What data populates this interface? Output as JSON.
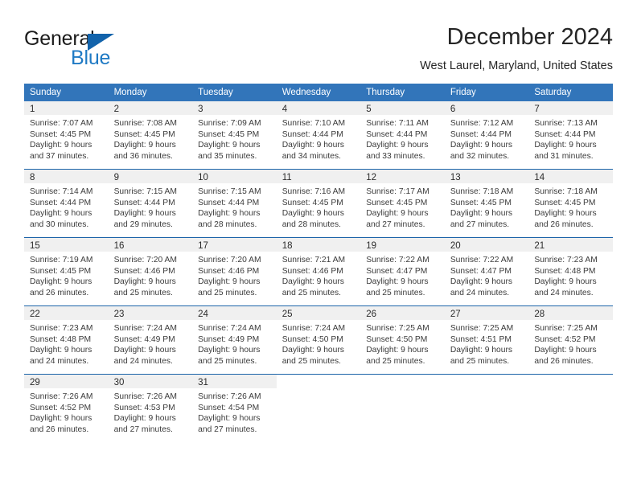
{
  "brand": {
    "name_part1": "General",
    "name_part2": "Blue"
  },
  "header": {
    "month_title": "December 2024",
    "location": "West Laurel, Maryland, United States"
  },
  "colors": {
    "header_blue": "#3275ba",
    "separator_blue": "#1b63a8",
    "daynum_band": "#f0f0f0",
    "brand_blue": "#1f7ac4",
    "logo_triangle": "#1263ab"
  },
  "weekday_headers": [
    "Sunday",
    "Monday",
    "Tuesday",
    "Wednesday",
    "Thursday",
    "Friday",
    "Saturday"
  ],
  "weeks": [
    [
      {
        "day": "1",
        "sunrise": "Sunrise: 7:07 AM",
        "sunset": "Sunset: 4:45 PM",
        "daylight1": "Daylight: 9 hours",
        "daylight2": "and 37 minutes."
      },
      {
        "day": "2",
        "sunrise": "Sunrise: 7:08 AM",
        "sunset": "Sunset: 4:45 PM",
        "daylight1": "Daylight: 9 hours",
        "daylight2": "and 36 minutes."
      },
      {
        "day": "3",
        "sunrise": "Sunrise: 7:09 AM",
        "sunset": "Sunset: 4:45 PM",
        "daylight1": "Daylight: 9 hours",
        "daylight2": "and 35 minutes."
      },
      {
        "day": "4",
        "sunrise": "Sunrise: 7:10 AM",
        "sunset": "Sunset: 4:44 PM",
        "daylight1": "Daylight: 9 hours",
        "daylight2": "and 34 minutes."
      },
      {
        "day": "5",
        "sunrise": "Sunrise: 7:11 AM",
        "sunset": "Sunset: 4:44 PM",
        "daylight1": "Daylight: 9 hours",
        "daylight2": "and 33 minutes."
      },
      {
        "day": "6",
        "sunrise": "Sunrise: 7:12 AM",
        "sunset": "Sunset: 4:44 PM",
        "daylight1": "Daylight: 9 hours",
        "daylight2": "and 32 minutes."
      },
      {
        "day": "7",
        "sunrise": "Sunrise: 7:13 AM",
        "sunset": "Sunset: 4:44 PM",
        "daylight1": "Daylight: 9 hours",
        "daylight2": "and 31 minutes."
      }
    ],
    [
      {
        "day": "8",
        "sunrise": "Sunrise: 7:14 AM",
        "sunset": "Sunset: 4:44 PM",
        "daylight1": "Daylight: 9 hours",
        "daylight2": "and 30 minutes."
      },
      {
        "day": "9",
        "sunrise": "Sunrise: 7:15 AM",
        "sunset": "Sunset: 4:44 PM",
        "daylight1": "Daylight: 9 hours",
        "daylight2": "and 29 minutes."
      },
      {
        "day": "10",
        "sunrise": "Sunrise: 7:15 AM",
        "sunset": "Sunset: 4:44 PM",
        "daylight1": "Daylight: 9 hours",
        "daylight2": "and 28 minutes."
      },
      {
        "day": "11",
        "sunrise": "Sunrise: 7:16 AM",
        "sunset": "Sunset: 4:45 PM",
        "daylight1": "Daylight: 9 hours",
        "daylight2": "and 28 minutes."
      },
      {
        "day": "12",
        "sunrise": "Sunrise: 7:17 AM",
        "sunset": "Sunset: 4:45 PM",
        "daylight1": "Daylight: 9 hours",
        "daylight2": "and 27 minutes."
      },
      {
        "day": "13",
        "sunrise": "Sunrise: 7:18 AM",
        "sunset": "Sunset: 4:45 PM",
        "daylight1": "Daylight: 9 hours",
        "daylight2": "and 27 minutes."
      },
      {
        "day": "14",
        "sunrise": "Sunrise: 7:18 AM",
        "sunset": "Sunset: 4:45 PM",
        "daylight1": "Daylight: 9 hours",
        "daylight2": "and 26 minutes."
      }
    ],
    [
      {
        "day": "15",
        "sunrise": "Sunrise: 7:19 AM",
        "sunset": "Sunset: 4:45 PM",
        "daylight1": "Daylight: 9 hours",
        "daylight2": "and 26 minutes."
      },
      {
        "day": "16",
        "sunrise": "Sunrise: 7:20 AM",
        "sunset": "Sunset: 4:46 PM",
        "daylight1": "Daylight: 9 hours",
        "daylight2": "and 25 minutes."
      },
      {
        "day": "17",
        "sunrise": "Sunrise: 7:20 AM",
        "sunset": "Sunset: 4:46 PM",
        "daylight1": "Daylight: 9 hours",
        "daylight2": "and 25 minutes."
      },
      {
        "day": "18",
        "sunrise": "Sunrise: 7:21 AM",
        "sunset": "Sunset: 4:46 PM",
        "daylight1": "Daylight: 9 hours",
        "daylight2": "and 25 minutes."
      },
      {
        "day": "19",
        "sunrise": "Sunrise: 7:22 AM",
        "sunset": "Sunset: 4:47 PM",
        "daylight1": "Daylight: 9 hours",
        "daylight2": "and 25 minutes."
      },
      {
        "day": "20",
        "sunrise": "Sunrise: 7:22 AM",
        "sunset": "Sunset: 4:47 PM",
        "daylight1": "Daylight: 9 hours",
        "daylight2": "and 24 minutes."
      },
      {
        "day": "21",
        "sunrise": "Sunrise: 7:23 AM",
        "sunset": "Sunset: 4:48 PM",
        "daylight1": "Daylight: 9 hours",
        "daylight2": "and 24 minutes."
      }
    ],
    [
      {
        "day": "22",
        "sunrise": "Sunrise: 7:23 AM",
        "sunset": "Sunset: 4:48 PM",
        "daylight1": "Daylight: 9 hours",
        "daylight2": "and 24 minutes."
      },
      {
        "day": "23",
        "sunrise": "Sunrise: 7:24 AM",
        "sunset": "Sunset: 4:49 PM",
        "daylight1": "Daylight: 9 hours",
        "daylight2": "and 24 minutes."
      },
      {
        "day": "24",
        "sunrise": "Sunrise: 7:24 AM",
        "sunset": "Sunset: 4:49 PM",
        "daylight1": "Daylight: 9 hours",
        "daylight2": "and 25 minutes."
      },
      {
        "day": "25",
        "sunrise": "Sunrise: 7:24 AM",
        "sunset": "Sunset: 4:50 PM",
        "daylight1": "Daylight: 9 hours",
        "daylight2": "and 25 minutes."
      },
      {
        "day": "26",
        "sunrise": "Sunrise: 7:25 AM",
        "sunset": "Sunset: 4:50 PM",
        "daylight1": "Daylight: 9 hours",
        "daylight2": "and 25 minutes."
      },
      {
        "day": "27",
        "sunrise": "Sunrise: 7:25 AM",
        "sunset": "Sunset: 4:51 PM",
        "daylight1": "Daylight: 9 hours",
        "daylight2": "and 25 minutes."
      },
      {
        "day": "28",
        "sunrise": "Sunrise: 7:25 AM",
        "sunset": "Sunset: 4:52 PM",
        "daylight1": "Daylight: 9 hours",
        "daylight2": "and 26 minutes."
      }
    ],
    [
      {
        "day": "29",
        "sunrise": "Sunrise: 7:26 AM",
        "sunset": "Sunset: 4:52 PM",
        "daylight1": "Daylight: 9 hours",
        "daylight2": "and 26 minutes."
      },
      {
        "day": "30",
        "sunrise": "Sunrise: 7:26 AM",
        "sunset": "Sunset: 4:53 PM",
        "daylight1": "Daylight: 9 hours",
        "daylight2": "and 27 minutes."
      },
      {
        "day": "31",
        "sunrise": "Sunrise: 7:26 AM",
        "sunset": "Sunset: 4:54 PM",
        "daylight1": "Daylight: 9 hours",
        "daylight2": "and 27 minutes."
      },
      {
        "day": "",
        "sunrise": "",
        "sunset": "",
        "daylight1": "",
        "daylight2": ""
      },
      {
        "day": "",
        "sunrise": "",
        "sunset": "",
        "daylight1": "",
        "daylight2": ""
      },
      {
        "day": "",
        "sunrise": "",
        "sunset": "",
        "daylight1": "",
        "daylight2": ""
      },
      {
        "day": "",
        "sunrise": "",
        "sunset": "",
        "daylight1": "",
        "daylight2": ""
      }
    ]
  ]
}
